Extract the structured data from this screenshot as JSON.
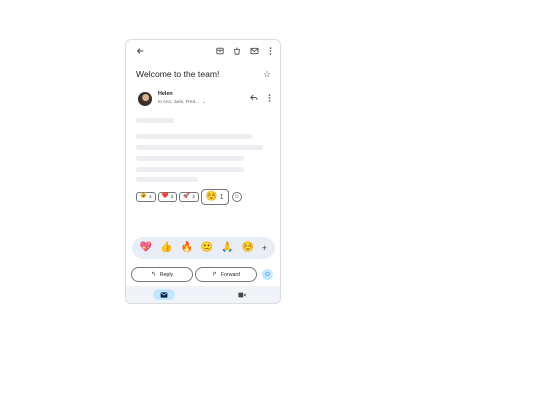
{
  "toolbar": {
    "back_icon": "arrow-back-icon",
    "archive_icon": "archive-icon",
    "delete_icon": "trash-icon",
    "unread_icon": "mail-icon",
    "more_icon": "more-vert-icon"
  },
  "email": {
    "subject": "Welcome to the team!",
    "sender": "Helen",
    "recipients": "to Ann, Julie, Fred...",
    "recipients_expand": "⌄"
  },
  "reactions": [
    {
      "emoji": "😺",
      "count": "4"
    },
    {
      "emoji": "❤️",
      "count": "3"
    },
    {
      "emoji": "🚀",
      "count": "2"
    },
    {
      "emoji": "☺️",
      "count": "1"
    }
  ],
  "emoji_picker": [
    "💖",
    "👍",
    "🔥",
    "🙁",
    "🙏",
    "☺️"
  ],
  "actions": {
    "reply_label": "Reply",
    "forward_label": "Forward"
  },
  "colors": {
    "accent": "#c2e7ff",
    "surface": "#e9eef6"
  }
}
